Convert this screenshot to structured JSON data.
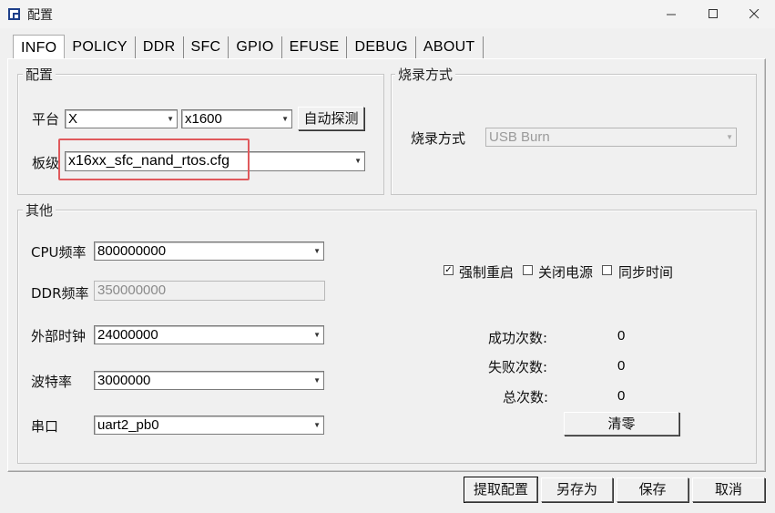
{
  "window": {
    "title": "配置",
    "minimize_icon": "minimize-icon",
    "maximize_icon": "maximize-icon",
    "close_icon": "close-icon"
  },
  "tabs": [
    "INFO",
    "POLICY",
    "DDR",
    "SFC",
    "GPIO",
    "EFUSE",
    "DEBUG",
    "ABOUT"
  ],
  "active_tab": "INFO",
  "config_group": {
    "label": "配置",
    "platform_label": "平台",
    "platform_value": "X",
    "chip_value": "x1600",
    "detect_button": "自动探测",
    "board_label": "板级",
    "board_value": "x16xx_sfc_nand_rtos.cfg"
  },
  "burn_group": {
    "label": "烧录方式",
    "method_label": "烧录方式",
    "method_value": "USB Burn"
  },
  "other_group": {
    "label": "其他",
    "cpu_label": "CPU频率",
    "cpu_value": "800000000",
    "ddr_label": "DDR频率",
    "ddr_value": "350000000",
    "ext_clock_label": "外部时钟",
    "ext_clock_value": "24000000",
    "baud_label": "波特率",
    "baud_value": "3000000",
    "serial_label": "串口",
    "serial_value": "uart2_pb0",
    "force_reboot_label": "强制重启",
    "force_reboot_checked": true,
    "power_off_label": "关闭电源",
    "power_off_checked": false,
    "sync_time_label": "同步时间",
    "sync_time_checked": false,
    "success_label": "成功次数:",
    "success_value": "0",
    "fail_label": "失败次数:",
    "fail_value": "0",
    "total_label": "总次数:",
    "total_value": "0",
    "clear_button": "清零"
  },
  "footer": {
    "fetch_button": "提取配置",
    "save_as_button": "另存为",
    "save_button": "保存",
    "cancel_button": "取消"
  },
  "colors": {
    "highlight_border": "#e0595c",
    "app_icon": "#1e3f8a"
  }
}
